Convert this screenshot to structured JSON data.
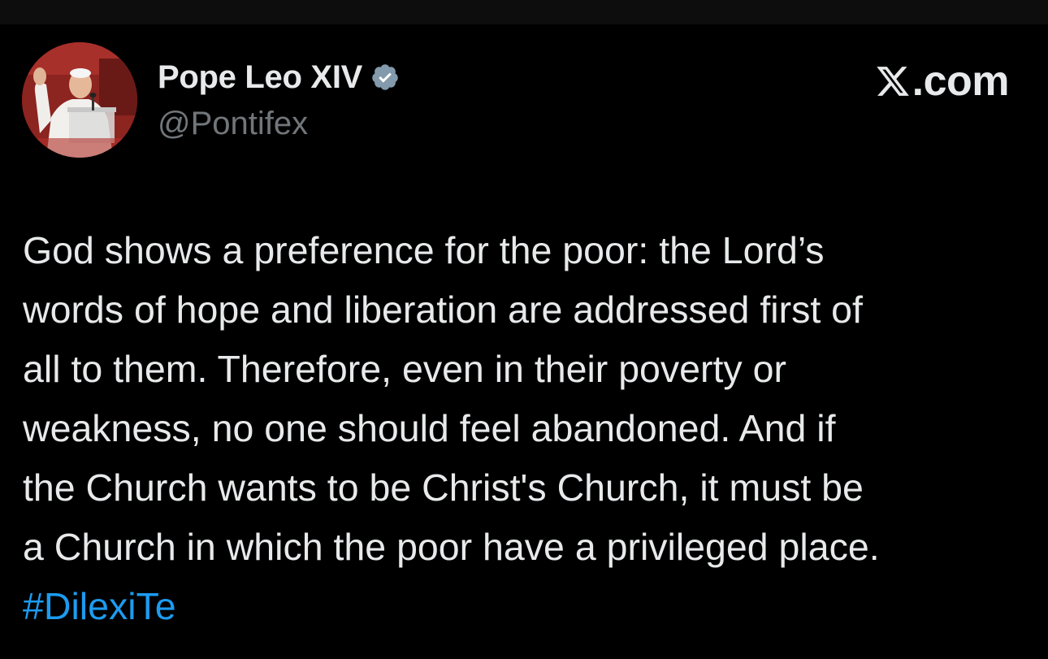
{
  "author": {
    "display_name": "Pope Leo XIV",
    "handle": "@Pontifex",
    "verified": true,
    "verified_icon": "verified-badge-icon",
    "verified_color": "#829aab"
  },
  "brand": {
    "icon": "x-logo-icon",
    "label": ".com"
  },
  "tweet": {
    "lines": [
      "God shows a preference for the poor: the Lord’s",
      "words of hope and liberation are addressed first of",
      "all to them. Therefore, even in their poverty or",
      "weakness, no one should feel abandoned. And if",
      "the Church wants to be Christ's Church, it must be",
      "a Church in which the poor have a privileged place."
    ],
    "hashtag": "#DilexiTe"
  },
  "colors": {
    "background": "#000000",
    "text": "#e7e9ea",
    "secondary_text": "#71767b",
    "link": "#1d9bf0"
  }
}
